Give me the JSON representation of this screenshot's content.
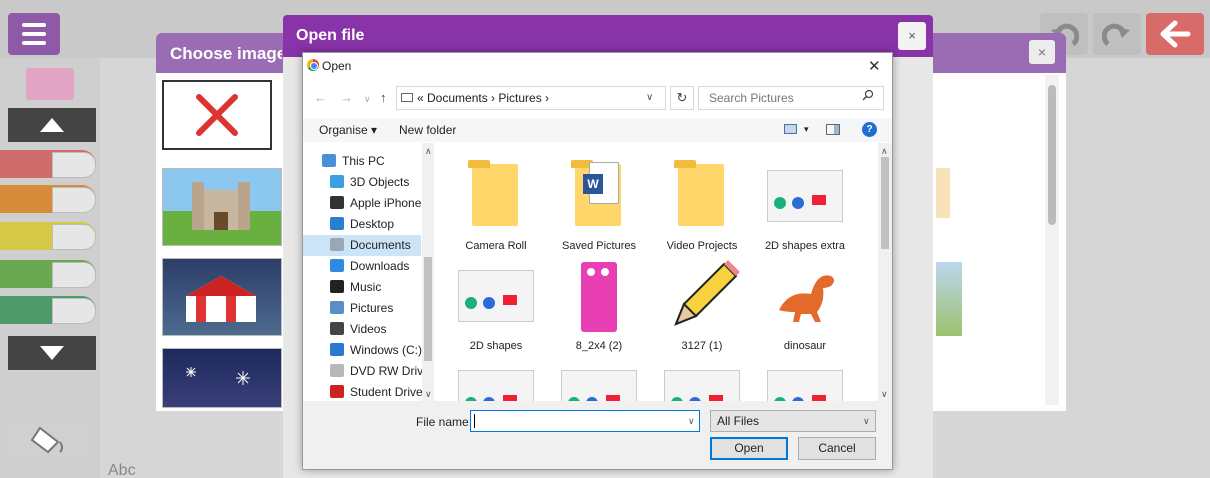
{
  "app": {
    "choose_title": "Choose image",
    "abc_label": "Abc",
    "colors": {
      "purple": "#8833a8",
      "panel_purple": "#9a6cb4",
      "back": "#d96a6a"
    }
  },
  "overlay": {
    "title": "Open file",
    "close_glyph": "×"
  },
  "dialog": {
    "title": "Open",
    "close_glyph": "✕",
    "address": "« Documents › Pictures ›",
    "search_placeholder": "Search Pictures",
    "toolbar": {
      "organise": "Organise ▾",
      "new_folder": "New folder",
      "help": "?"
    },
    "tree": [
      {
        "label": "This PC",
        "icon": "computer-icon",
        "color": "#4a90d9"
      },
      {
        "label": "3D Objects",
        "icon": "cube-icon",
        "color": "#3aa0e0"
      },
      {
        "label": "Apple iPhone",
        "icon": "phone-icon",
        "color": "#333333"
      },
      {
        "label": "Desktop",
        "icon": "desktop-icon",
        "color": "#2a7fd4"
      },
      {
        "label": "Documents",
        "icon": "document-icon",
        "color": "#9aa7b4"
      },
      {
        "label": "Downloads",
        "icon": "download-icon",
        "color": "#2d8ae0"
      },
      {
        "label": "Music",
        "icon": "music-icon",
        "color": "#222222"
      },
      {
        "label": "Pictures",
        "icon": "pictures-icon",
        "color": "#5a8fc5"
      },
      {
        "label": "Videos",
        "icon": "video-icon",
        "color": "#444444"
      },
      {
        "label": "Windows (C:)",
        "icon": "drive-icon",
        "color": "#2b78d0"
      },
      {
        "label": "DVD RW Drive (",
        "icon": "dvd-icon",
        "color": "#b8b8b8"
      },
      {
        "label": "Student Drive (\\",
        "icon": "network-drive-icon",
        "color": "#cc2222"
      }
    ],
    "files": [
      {
        "label": "Camera Roll",
        "icon": "folder-icon"
      },
      {
        "label": "Saved Pictures",
        "icon": "folder-word-icon"
      },
      {
        "label": "Video Projects",
        "icon": "folder-icon"
      },
      {
        "label": "2D shapes extra",
        "icon": "image-thumbnail-icon"
      },
      {
        "label": "2D shapes",
        "icon": "image-thumbnail-icon"
      },
      {
        "label": "8_2x4 (2)",
        "icon": "numberblock-image-icon"
      },
      {
        "label": "3127 (1)",
        "icon": "pencil-image-icon"
      },
      {
        "label": "dinosaur",
        "icon": "dinosaur-image-icon"
      },
      {
        "label": "",
        "icon": "image-thumbnail-icon"
      },
      {
        "label": "",
        "icon": "image-thumbnail-icon"
      },
      {
        "label": "",
        "icon": "image-thumbnail-icon"
      },
      {
        "label": "",
        "icon": "image-thumbnail-icon"
      }
    ],
    "file_name_label": "File name:",
    "file_name_value": "",
    "filter": "All Files",
    "open_button": "Open",
    "cancel_button": "Cancel"
  }
}
